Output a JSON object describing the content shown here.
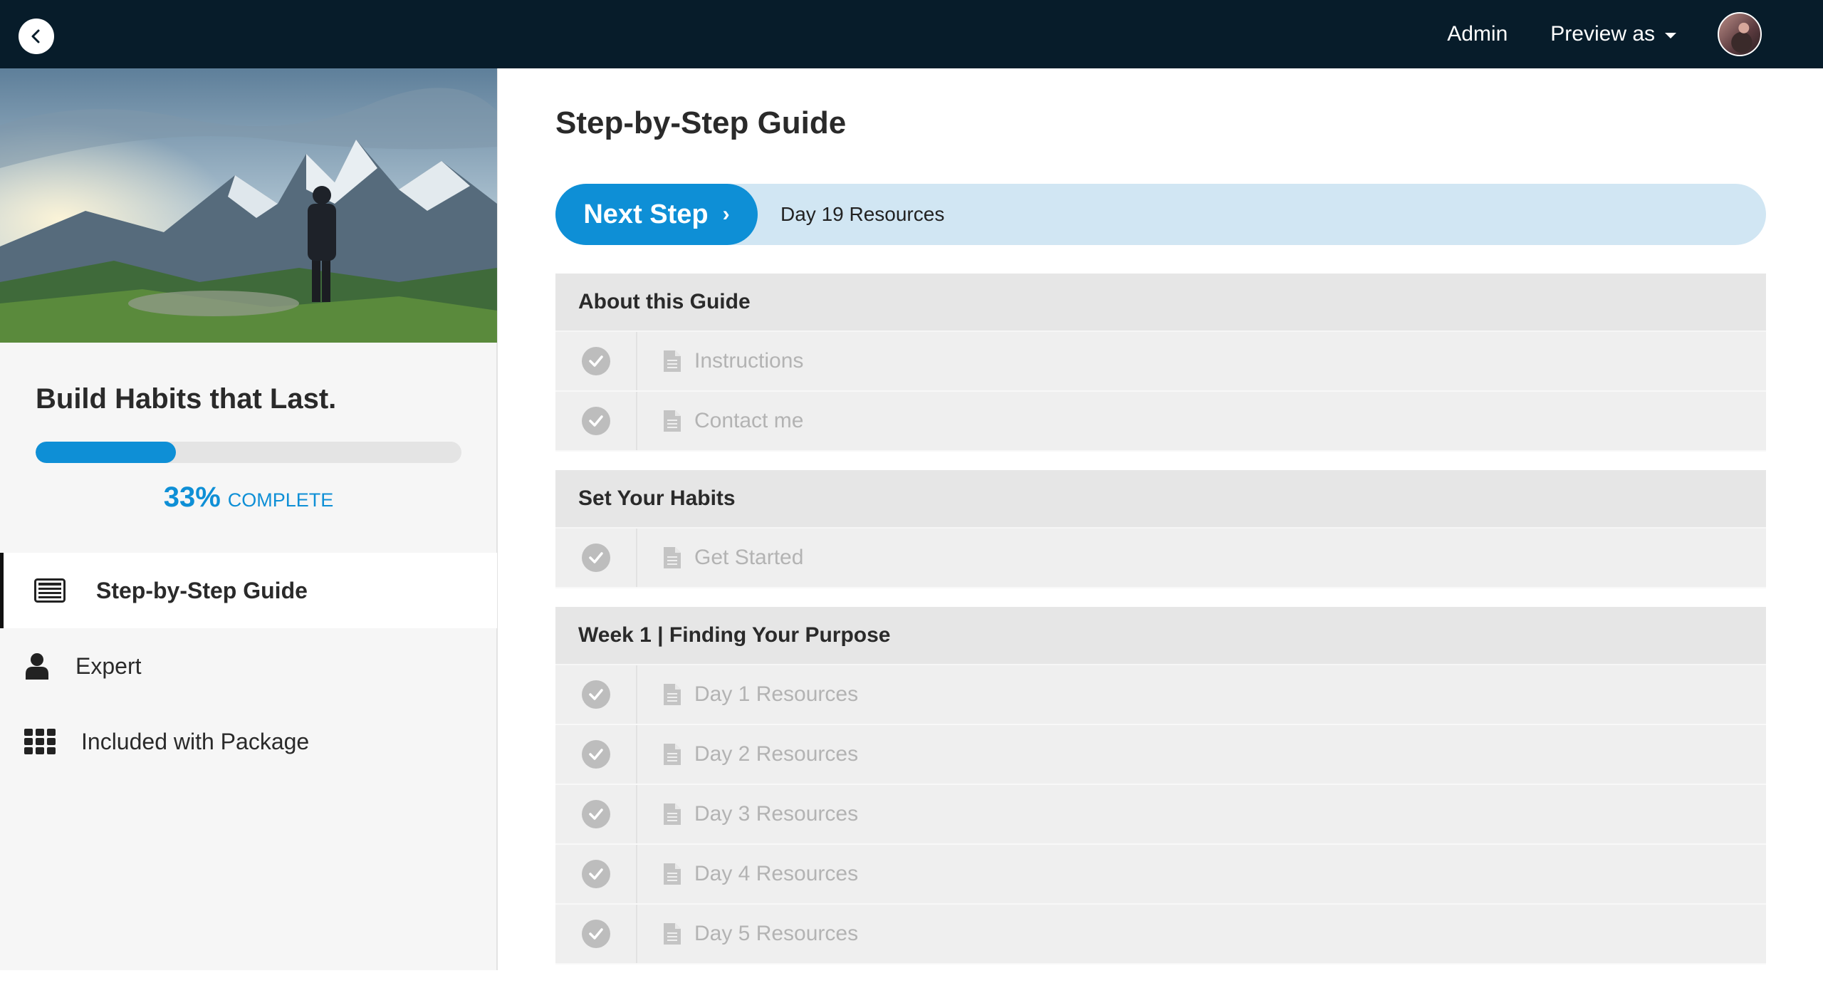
{
  "topbar": {
    "back_icon": "chevron-left-icon",
    "admin_label": "Admin",
    "preview_label": "Preview as"
  },
  "sidebar": {
    "course_title": "Build Habits that Last.",
    "progress": {
      "percent": 33,
      "percent_label": "33%",
      "complete_label": "COMPLETE",
      "color": "#0e8fd6"
    },
    "nav": [
      {
        "label": "Step-by-Step Guide",
        "icon": "list-icon",
        "active": true
      },
      {
        "label": "Expert",
        "icon": "user-icon",
        "active": false
      },
      {
        "label": "Included with Package",
        "icon": "grid-icon",
        "active": false
      }
    ]
  },
  "main": {
    "title": "Step-by-Step Guide",
    "next_step": {
      "button_label": "Next Step",
      "arrow": "›",
      "target": "Day 19 Resources"
    },
    "sections": [
      {
        "title": "About this Guide",
        "lessons": [
          {
            "title": "Instructions",
            "completed": true
          },
          {
            "title": "Contact me",
            "completed": true
          }
        ]
      },
      {
        "title": "Set Your Habits",
        "lessons": [
          {
            "title": "Get Started",
            "completed": true
          }
        ]
      },
      {
        "title": "Week 1 | Finding Your Purpose",
        "lessons": [
          {
            "title": "Day 1 Resources",
            "completed": true
          },
          {
            "title": "Day 2 Resources",
            "completed": true
          },
          {
            "title": "Day 3 Resources",
            "completed": true
          },
          {
            "title": "Day 4 Resources",
            "completed": true
          },
          {
            "title": "Day 5 Resources",
            "completed": true
          }
        ]
      }
    ]
  }
}
